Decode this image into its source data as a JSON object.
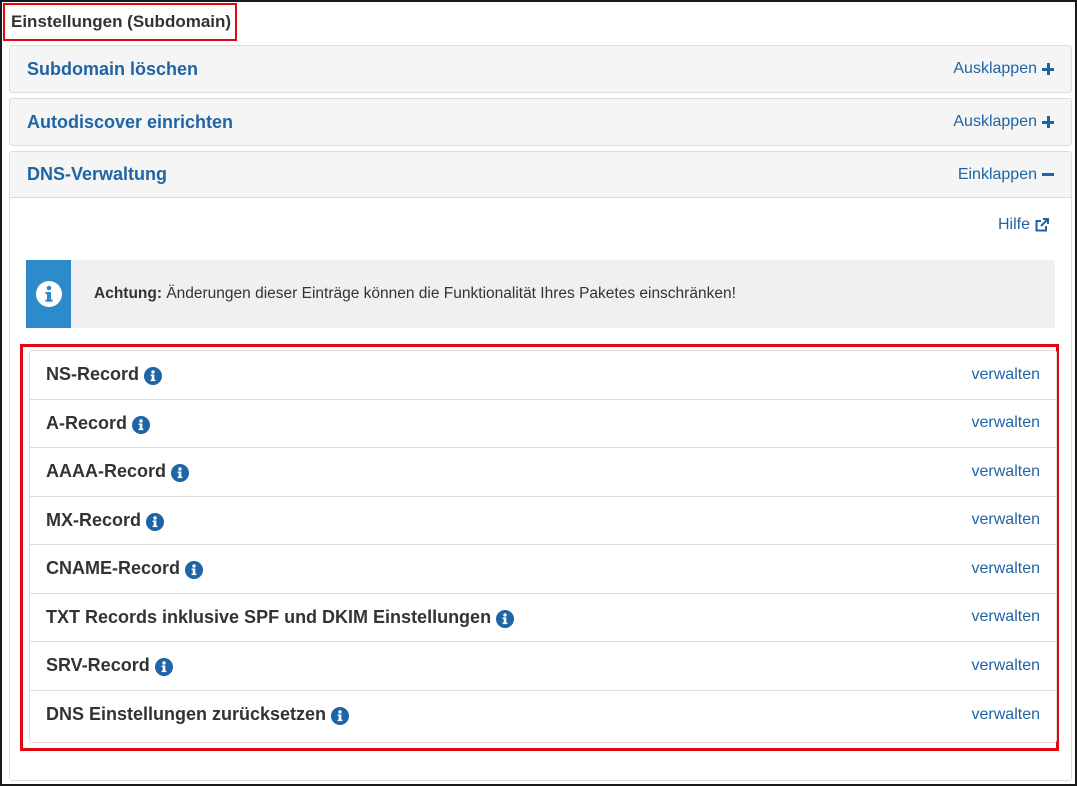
{
  "page": {
    "title": "Einstellungen (Subdomain)"
  },
  "panels": [
    {
      "title": "Subdomain löschen",
      "toggle_label": "Ausklappen",
      "toggle_icon": "plus-icon"
    },
    {
      "title": "Autodiscover einrichten",
      "toggle_label": "Ausklappen",
      "toggle_icon": "plus-icon"
    }
  ],
  "dns_panel": {
    "title": "DNS-Verwaltung",
    "toggle_label": "Einklappen",
    "toggle_icon": "minus-icon",
    "help_label": "Hilfe",
    "help_icon": "external-link-icon",
    "alert": {
      "icon": "info-icon",
      "strong": "Achtung:",
      "text": " Änderungen dieser Einträge können die Funktionalität Ihres Paketes einschränken!"
    },
    "records": [
      {
        "name": "NS-Record",
        "action": "verwalten"
      },
      {
        "name": "A-Record",
        "action": "verwalten"
      },
      {
        "name": "AAAA-Record",
        "action": "verwalten"
      },
      {
        "name": "MX-Record",
        "action": "verwalten"
      },
      {
        "name": "CNAME-Record",
        "action": "verwalten"
      },
      {
        "name": "TXT Records inklusive SPF und DKIM Einstellungen",
        "action": "verwalten"
      },
      {
        "name": "SRV-Record",
        "action": "verwalten"
      },
      {
        "name": "DNS Einstellungen zurücksetzen",
        "action": "verwalten"
      }
    ]
  },
  "colors": {
    "link": "#1f64a5",
    "highlight_border": "#e30613",
    "alert_accent": "#2d8acb",
    "panel_bg": "#f5f5f5"
  }
}
